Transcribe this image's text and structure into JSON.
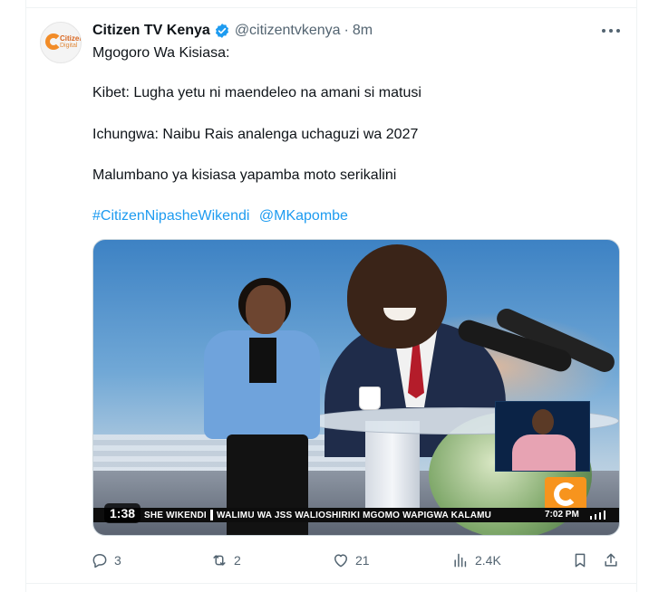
{
  "tweet": {
    "display_name": "Citizen TV Kenya",
    "handle": "@citizentvkenya",
    "separator": "·",
    "time": "8m",
    "lines": [
      "Mgogoro Wa Kisiasa:",
      "Kibet: Lugha yetu ni maendeleo na amani si matusi",
      "Ichungwa: Naibu Rais analenga uchaguzi wa 2027",
      "Malumbano ya kisiasa yapamba moto serikalini"
    ],
    "hashtag": "#CitizenNipasheWikendi",
    "mention": "@MKapombe",
    "avatar_text": {
      "line1": "Citizen",
      "line2": "Digital"
    }
  },
  "media": {
    "duration": "1:38",
    "ticker_left": "SHE WIKENDI",
    "ticker_main": "WALIMU WA JSS WALIOSHIRIKI MGOMO WAPIGWA KALAMU",
    "ticker_time": "7:02 PM"
  },
  "actions": {
    "replies": "3",
    "retweets": "2",
    "likes": "21",
    "views": "2.4K"
  },
  "colors": {
    "link": "#1d9bf0",
    "muted": "#536471",
    "verified": "#1d9bf0",
    "brand_orange": "#f7941d"
  },
  "icons": [
    "verified-badge-icon",
    "more-icon",
    "reply-icon",
    "retweet-icon",
    "like-icon",
    "views-icon",
    "bookmark-icon",
    "share-icon"
  ]
}
